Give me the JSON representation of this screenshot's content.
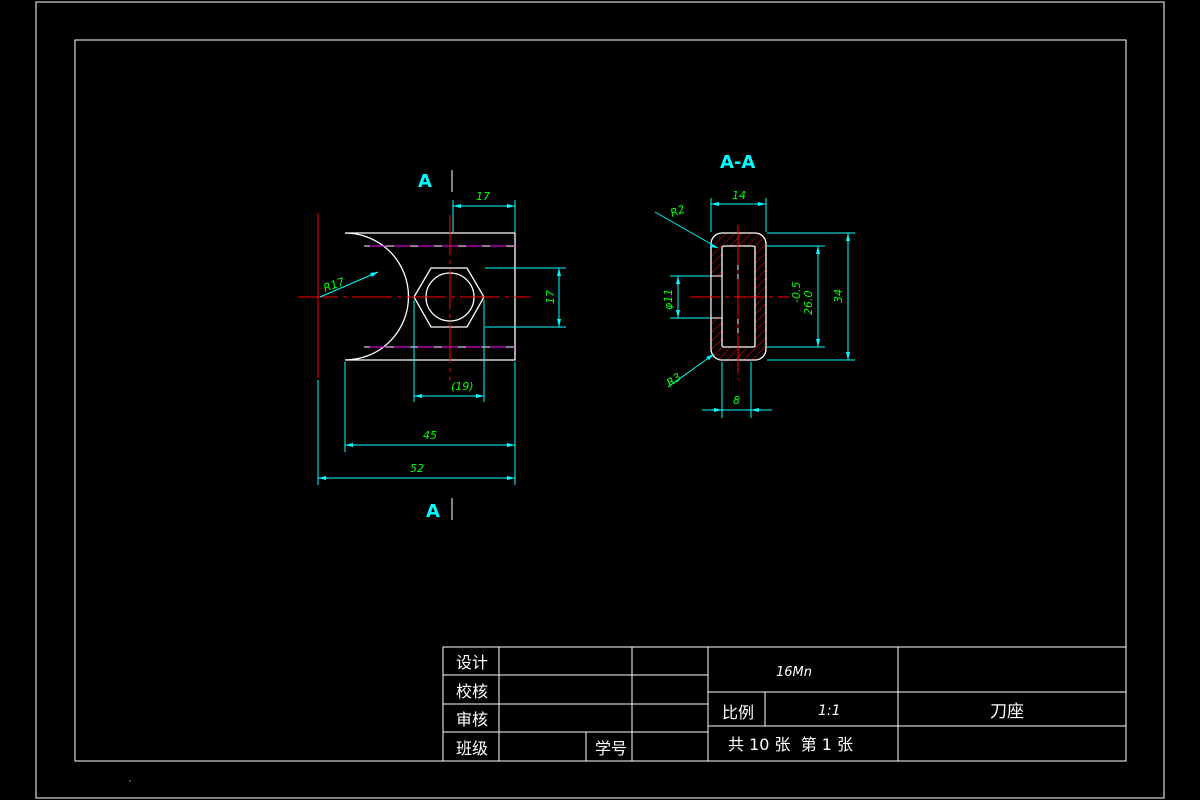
{
  "colors": {
    "background": "#000000",
    "outline": "#ffffff",
    "dimension": "#00ffff",
    "dimension_text": "#00ff00",
    "centerline": "#ff0000",
    "hidden_line": "#ff00ff"
  },
  "views": {
    "front": {
      "section_mark_top": "A",
      "section_mark_bottom": "A",
      "dims": {
        "d17_top": "17",
        "d17_right": "17",
        "r17": "R17",
        "d19": "(19)",
        "d45": "45",
        "d52": "52"
      }
    },
    "section": {
      "title": "A-A",
      "dims": {
        "d14": "14",
        "r2": "R2",
        "phi11": "φ11",
        "d26": "26.0",
        "d26_tol": "-0.5",
        "d34": "34",
        "r3": "R3",
        "d8": "8"
      }
    }
  },
  "title_block": {
    "design": "设计",
    "check": "校核",
    "review": "审核",
    "class": "班级",
    "student_no": "学号",
    "material": "16Mn",
    "scale_label": "比例",
    "scale_value": "1:1",
    "part_name": "刀座",
    "sheets": "共 10 张  第 1 张"
  }
}
